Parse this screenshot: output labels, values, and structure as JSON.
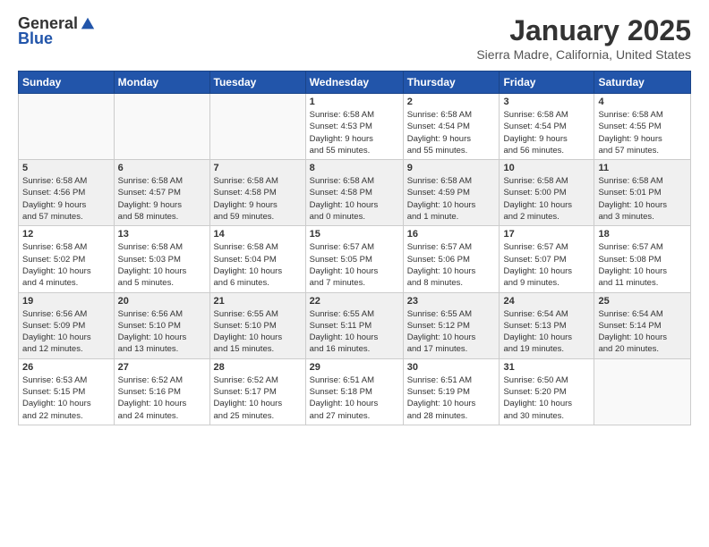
{
  "header": {
    "logo_general": "General",
    "logo_blue": "Blue",
    "month_title": "January 2025",
    "location": "Sierra Madre, California, United States"
  },
  "weekdays": [
    "Sunday",
    "Monday",
    "Tuesday",
    "Wednesday",
    "Thursday",
    "Friday",
    "Saturday"
  ],
  "weeks": [
    [
      {
        "day": "",
        "info": ""
      },
      {
        "day": "",
        "info": ""
      },
      {
        "day": "",
        "info": ""
      },
      {
        "day": "1",
        "info": "Sunrise: 6:58 AM\nSunset: 4:53 PM\nDaylight: 9 hours\nand 55 minutes."
      },
      {
        "day": "2",
        "info": "Sunrise: 6:58 AM\nSunset: 4:54 PM\nDaylight: 9 hours\nand 55 minutes."
      },
      {
        "day": "3",
        "info": "Sunrise: 6:58 AM\nSunset: 4:54 PM\nDaylight: 9 hours\nand 56 minutes."
      },
      {
        "day": "4",
        "info": "Sunrise: 6:58 AM\nSunset: 4:55 PM\nDaylight: 9 hours\nand 57 minutes."
      }
    ],
    [
      {
        "day": "5",
        "info": "Sunrise: 6:58 AM\nSunset: 4:56 PM\nDaylight: 9 hours\nand 57 minutes."
      },
      {
        "day": "6",
        "info": "Sunrise: 6:58 AM\nSunset: 4:57 PM\nDaylight: 9 hours\nand 58 minutes."
      },
      {
        "day": "7",
        "info": "Sunrise: 6:58 AM\nSunset: 4:58 PM\nDaylight: 9 hours\nand 59 minutes."
      },
      {
        "day": "8",
        "info": "Sunrise: 6:58 AM\nSunset: 4:58 PM\nDaylight: 10 hours\nand 0 minutes."
      },
      {
        "day": "9",
        "info": "Sunrise: 6:58 AM\nSunset: 4:59 PM\nDaylight: 10 hours\nand 1 minute."
      },
      {
        "day": "10",
        "info": "Sunrise: 6:58 AM\nSunset: 5:00 PM\nDaylight: 10 hours\nand 2 minutes."
      },
      {
        "day": "11",
        "info": "Sunrise: 6:58 AM\nSunset: 5:01 PM\nDaylight: 10 hours\nand 3 minutes."
      }
    ],
    [
      {
        "day": "12",
        "info": "Sunrise: 6:58 AM\nSunset: 5:02 PM\nDaylight: 10 hours\nand 4 minutes."
      },
      {
        "day": "13",
        "info": "Sunrise: 6:58 AM\nSunset: 5:03 PM\nDaylight: 10 hours\nand 5 minutes."
      },
      {
        "day": "14",
        "info": "Sunrise: 6:58 AM\nSunset: 5:04 PM\nDaylight: 10 hours\nand 6 minutes."
      },
      {
        "day": "15",
        "info": "Sunrise: 6:57 AM\nSunset: 5:05 PM\nDaylight: 10 hours\nand 7 minutes."
      },
      {
        "day": "16",
        "info": "Sunrise: 6:57 AM\nSunset: 5:06 PM\nDaylight: 10 hours\nand 8 minutes."
      },
      {
        "day": "17",
        "info": "Sunrise: 6:57 AM\nSunset: 5:07 PM\nDaylight: 10 hours\nand 9 minutes."
      },
      {
        "day": "18",
        "info": "Sunrise: 6:57 AM\nSunset: 5:08 PM\nDaylight: 10 hours\nand 11 minutes."
      }
    ],
    [
      {
        "day": "19",
        "info": "Sunrise: 6:56 AM\nSunset: 5:09 PM\nDaylight: 10 hours\nand 12 minutes."
      },
      {
        "day": "20",
        "info": "Sunrise: 6:56 AM\nSunset: 5:10 PM\nDaylight: 10 hours\nand 13 minutes."
      },
      {
        "day": "21",
        "info": "Sunrise: 6:55 AM\nSunset: 5:10 PM\nDaylight: 10 hours\nand 15 minutes."
      },
      {
        "day": "22",
        "info": "Sunrise: 6:55 AM\nSunset: 5:11 PM\nDaylight: 10 hours\nand 16 minutes."
      },
      {
        "day": "23",
        "info": "Sunrise: 6:55 AM\nSunset: 5:12 PM\nDaylight: 10 hours\nand 17 minutes."
      },
      {
        "day": "24",
        "info": "Sunrise: 6:54 AM\nSunset: 5:13 PM\nDaylight: 10 hours\nand 19 minutes."
      },
      {
        "day": "25",
        "info": "Sunrise: 6:54 AM\nSunset: 5:14 PM\nDaylight: 10 hours\nand 20 minutes."
      }
    ],
    [
      {
        "day": "26",
        "info": "Sunrise: 6:53 AM\nSunset: 5:15 PM\nDaylight: 10 hours\nand 22 minutes."
      },
      {
        "day": "27",
        "info": "Sunrise: 6:52 AM\nSunset: 5:16 PM\nDaylight: 10 hours\nand 24 minutes."
      },
      {
        "day": "28",
        "info": "Sunrise: 6:52 AM\nSunset: 5:17 PM\nDaylight: 10 hours\nand 25 minutes."
      },
      {
        "day": "29",
        "info": "Sunrise: 6:51 AM\nSunset: 5:18 PM\nDaylight: 10 hours\nand 27 minutes."
      },
      {
        "day": "30",
        "info": "Sunrise: 6:51 AM\nSunset: 5:19 PM\nDaylight: 10 hours\nand 28 minutes."
      },
      {
        "day": "31",
        "info": "Sunrise: 6:50 AM\nSunset: 5:20 PM\nDaylight: 10 hours\nand 30 minutes."
      },
      {
        "day": "",
        "info": ""
      }
    ]
  ]
}
